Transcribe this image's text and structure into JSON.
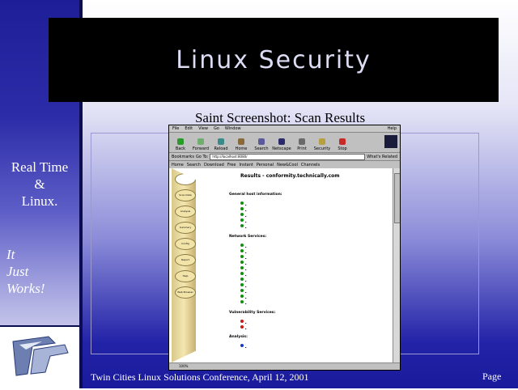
{
  "slide": {
    "title": "Linux Security",
    "subtitle": "Saint Screenshot: Scan Results",
    "left_text_1": [
      "Real Time",
      "&",
      "Linux."
    ],
    "left_text_2": [
      "It",
      "Just",
      "Works!"
    ],
    "footer": "Twin Cities Linux Solutions Conference, April 12, 2001",
    "page_label": "Page"
  },
  "browser": {
    "menu": [
      "File",
      "Edit",
      "View",
      "Go",
      "Window"
    ],
    "help": "Help",
    "toolbar": [
      "Back",
      "Forward",
      "Reload",
      "Home",
      "Search",
      "Netscape",
      "Print",
      "Security",
      "Stop"
    ],
    "location_label": "Bookmarks",
    "goto_label": "Go To:",
    "location_value": "http://localhost:8080/",
    "related": "What's Related",
    "personal": [
      "Home",
      "Search",
      "Download",
      "Free",
      "Instant",
      "Personal",
      "New&Cool",
      "Channels"
    ],
    "results_title": "Results - conformity.technically.com",
    "sections": [
      "General host information:",
      "Network Services:",
      "Vulnerability Services:",
      "Analysis:"
    ],
    "tools": [
      "Scan Data",
      "Analysis",
      "Summary",
      "Config",
      "Report",
      "Help",
      "Web Browser"
    ],
    "status": "100%"
  },
  "colors": {
    "title_bg": "#000000",
    "left_panel_top": "#1e1e98",
    "accent_blue": "#2323a8"
  }
}
